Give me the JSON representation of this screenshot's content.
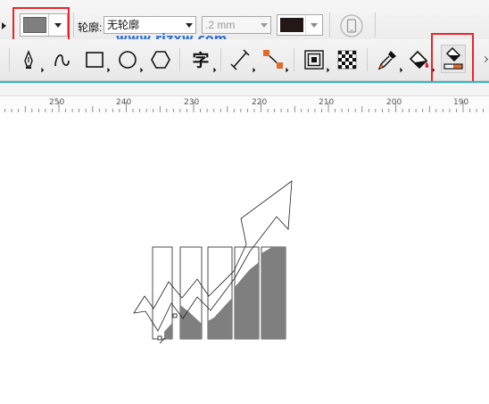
{
  "property_bar": {
    "fill_color_hex": "#7f7f7f",
    "outline_label": "轮廓:",
    "outline_value": "无轮廓",
    "width_value": ".2 mm",
    "outline_color_hex": "#231816",
    "highlight_color": "#e5272d"
  },
  "watermark": "www.rjzxw.com",
  "tools": [
    {
      "icon": "pen-icon"
    },
    {
      "icon": "bspline-icon"
    },
    {
      "icon": "rectangle-icon"
    },
    {
      "icon": "ellipse-icon"
    },
    {
      "icon": "polygon-icon"
    },
    {
      "icon": "text-icon",
      "label": "字"
    },
    {
      "icon": "dimension-icon"
    },
    {
      "icon": "connector-icon"
    },
    {
      "icon": "contour-icon"
    },
    {
      "icon": "transparency-icon"
    },
    {
      "icon": "eyedropper-icon"
    },
    {
      "icon": "fill-bucket-icon"
    },
    {
      "icon": "smart-fill-icon"
    }
  ],
  "ruler": {
    "ticks": [
      "250",
      "240",
      "230",
      "220",
      "210",
      "200",
      "190"
    ]
  },
  "canvas": {
    "bar_fill_hex": "#7f7f7f"
  }
}
